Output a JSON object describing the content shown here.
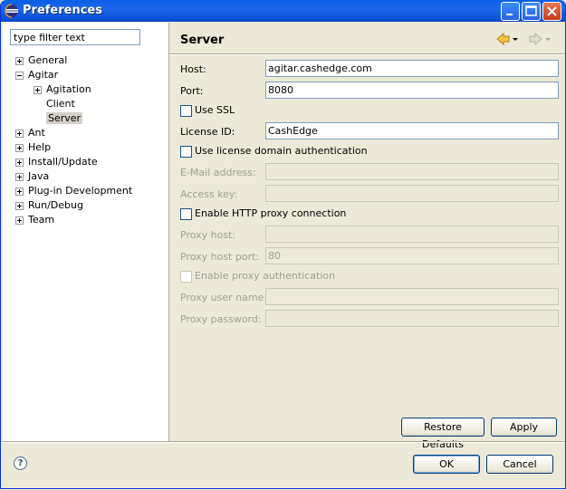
{
  "window": {
    "title": "Preferences"
  },
  "filter": {
    "value": "type filter text"
  },
  "tree": [
    {
      "label": "General",
      "expander": "plus"
    },
    {
      "label": "Agitar",
      "expander": "minus"
    },
    {
      "label": "Agitation",
      "expander": "plus"
    },
    {
      "label": "Client",
      "expander": "none"
    },
    {
      "label": "Server",
      "expander": "none",
      "selected": true
    },
    {
      "label": "Ant",
      "expander": "plus"
    },
    {
      "label": "Help",
      "expander": "plus"
    },
    {
      "label": "Install/Update",
      "expander": "plus"
    },
    {
      "label": "Java",
      "expander": "plus"
    },
    {
      "label": "Plug-in Development",
      "expander": "plus"
    },
    {
      "label": "Run/Debug",
      "expander": "plus"
    },
    {
      "label": "Team",
      "expander": "plus"
    }
  ],
  "page": {
    "title": "Server",
    "host_label": "Host:",
    "host_value": "agitar.cashedge.com",
    "port_label": "Port:",
    "port_value": "8080",
    "use_ssl_label": "Use SSL",
    "license_label": "License ID:",
    "license_value": "CashEdge",
    "use_license_domain_label": "Use license domain authentication",
    "email_label": "E-Mail address:",
    "email_value": "",
    "access_key_label": "Access key:",
    "access_key_value": "",
    "proxy_enable_label": "Enable HTTP proxy connection",
    "proxy_host_label": "Proxy host:",
    "proxy_host_value": "",
    "proxy_port_label": "Proxy host port:",
    "proxy_port_value": "80",
    "proxy_auth_label": "Enable proxy authentication",
    "proxy_user_label": "Proxy user name:",
    "proxy_user_value": "",
    "proxy_pass_label": "Proxy password:",
    "proxy_pass_value": ""
  },
  "buttons": {
    "restore_defaults": "Restore Defaults",
    "apply": "Apply",
    "ok": "OK",
    "cancel": "Cancel",
    "help": "?"
  },
  "colors": {
    "titlebar": "#0b51d6",
    "dialog_bg": "#ece9d8",
    "tree_bg": "#ffffff"
  }
}
